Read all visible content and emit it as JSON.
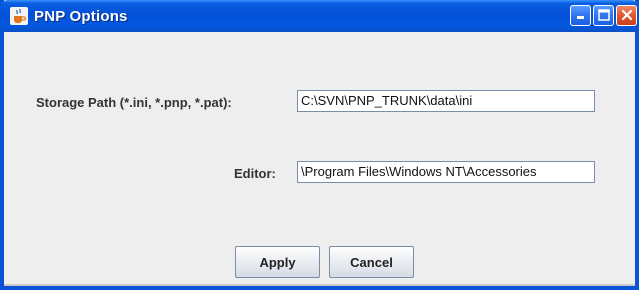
{
  "window": {
    "title": "PNP Options",
    "app_icon": "java-cup-icon",
    "controls": {
      "minimize": "minimize-icon",
      "maximize": "maximize-icon",
      "close": "close-icon"
    }
  },
  "form": {
    "storage_path_label": "Storage Path (*.ini, *.pnp, *.pat):",
    "storage_path_value": "C:\\SVN\\PNP_TRUNK\\data\\ini",
    "editor_label": "Editor:",
    "editor_value": "\\Program Files\\Windows NT\\Accessories"
  },
  "buttons": {
    "apply": "Apply",
    "cancel": "Cancel"
  },
  "colors": {
    "titlebar": "#0550d8",
    "frame": "#0a52d6",
    "panel": "#eeeeee",
    "close": "#e2562f"
  }
}
